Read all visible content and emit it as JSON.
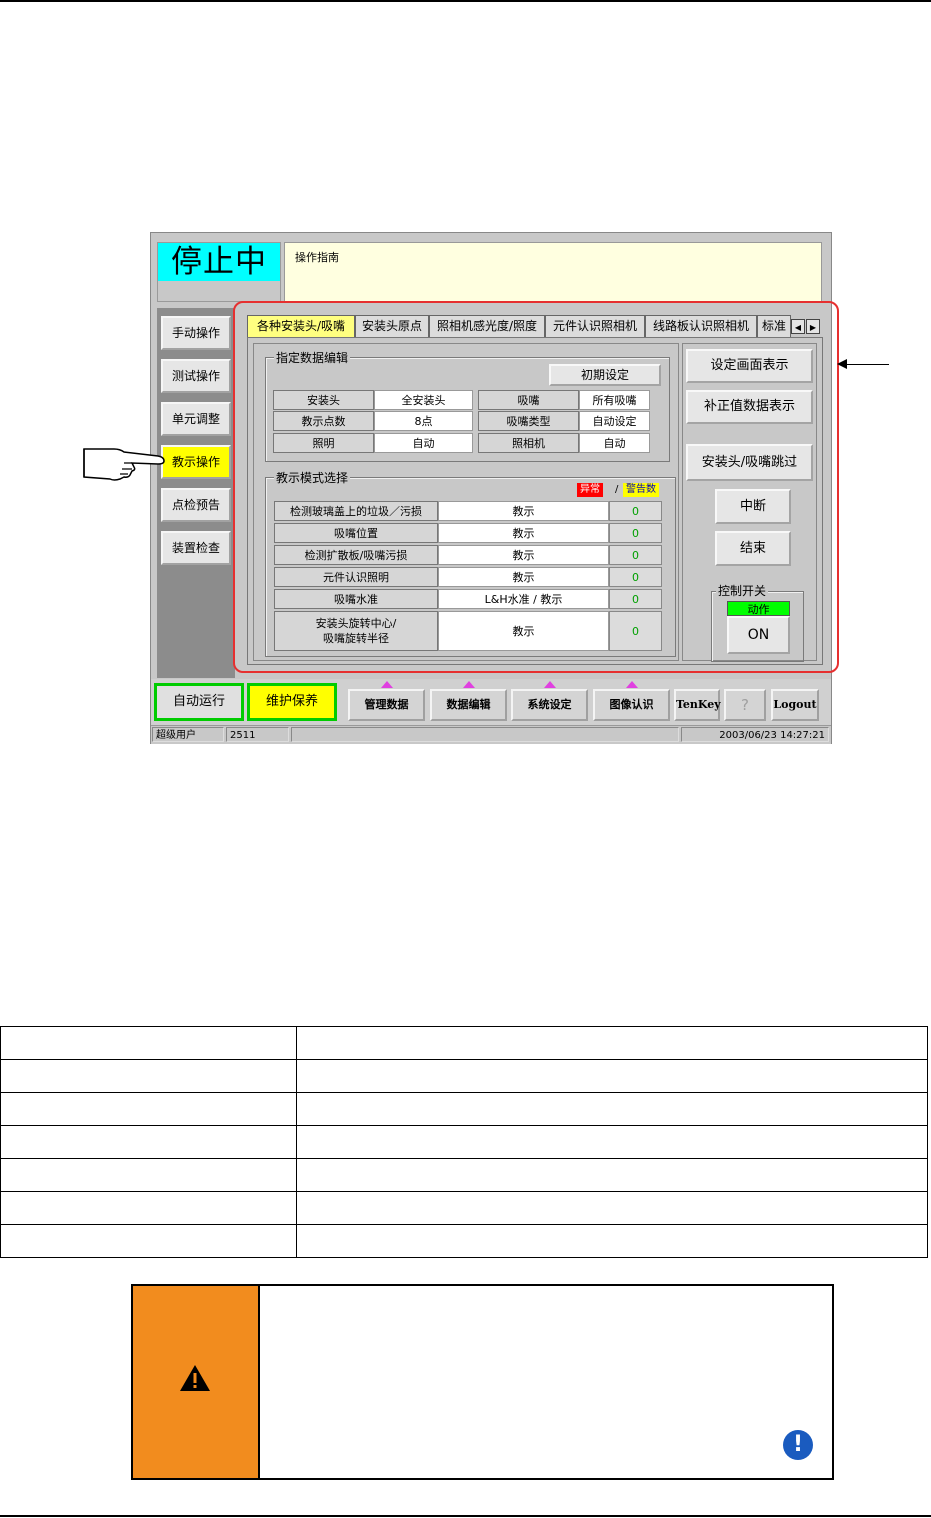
{
  "screen": {
    "status": "停止中",
    "guide_label": "操作指南",
    "sidebar": [
      {
        "label": "手动操作",
        "active": false
      },
      {
        "label": "测试操作",
        "active": false
      },
      {
        "label": "单元调整",
        "active": false
      },
      {
        "label": "教示操作",
        "active": true
      },
      {
        "label": "点检预告",
        "active": false
      },
      {
        "label": "装置检查",
        "active": false
      }
    ],
    "tabs": [
      "各种安装头/吸嘴",
      "安装头原点",
      "照相机感光度/照度",
      "元件认识照相机",
      "线路板认识照相机",
      "标准"
    ],
    "data_edit": {
      "title": "指定数据编辑",
      "init_button": "初期设定",
      "rows": [
        {
          "l1": "安装头",
          "v1": "全安装头",
          "l2": "吸嘴",
          "v2": "所有吸嘴"
        },
        {
          "l1": "教示点数",
          "v1": "8点",
          "l2": "吸嘴类型",
          "v2": "自动设定"
        },
        {
          "l1": "照明",
          "v1": "自动",
          "l2": "照相机",
          "v2": "自动"
        }
      ]
    },
    "teach_mode": {
      "title": "教示模式选择",
      "tag_error": "异常",
      "tag_sep": "/",
      "tag_warn": "警告数",
      "rows": [
        {
          "label": "检测玻璃盖上的垃圾／污损",
          "mode": "教示",
          "count": "0"
        },
        {
          "label": "吸嘴位置",
          "mode": "教示",
          "count": "0"
        },
        {
          "label": "检测扩散板/吸嘴污损",
          "mode": "教示",
          "count": "0"
        },
        {
          "label": "元件认识照明",
          "mode": "教示",
          "count": "0"
        },
        {
          "label": "吸嘴水准",
          "mode": "L&H水准 / 教示",
          "count": "0"
        },
        {
          "label_line1": "安装头旋转中心/",
          "label_line2": "吸嘴旋转半径",
          "mode": "教示",
          "count": "0"
        }
      ]
    },
    "right_buttons": {
      "settings_display": "设定画面表示",
      "correction_display": "补正值数据表示",
      "skip": "安装头/吸嘴跳过",
      "interrupt": "中断",
      "end": "结束"
    },
    "control_switch": {
      "title": "控制开关",
      "status": "动作",
      "button": "ON"
    },
    "bottom_bar": {
      "auto_run": "自动运行",
      "maintenance": "维护保养",
      "manage_data": "管理数据",
      "data_edit": "数据编辑",
      "system_setting": "系统设定",
      "image_recognition": "图像认识",
      "tenkey": "TenKey",
      "help": "?",
      "logout": "Logout"
    },
    "status_bar": {
      "user": "超级用户",
      "code": "2511",
      "datetime": "2003/06/23 14:27:21"
    }
  },
  "colors": {
    "status_bg": "#00ffff",
    "guide_bg": "#ffffe0",
    "active_yellow": "#ffff00",
    "highlight_frame": "#e63030",
    "warning_orange": "#f28c1e",
    "info_blue": "#1a5bbf",
    "status_green": "#00ff00"
  },
  "icons": {
    "pointer": "pointing-hand-icon",
    "warning": "warning-triangle-icon",
    "info": "exclamation-circle-icon"
  }
}
